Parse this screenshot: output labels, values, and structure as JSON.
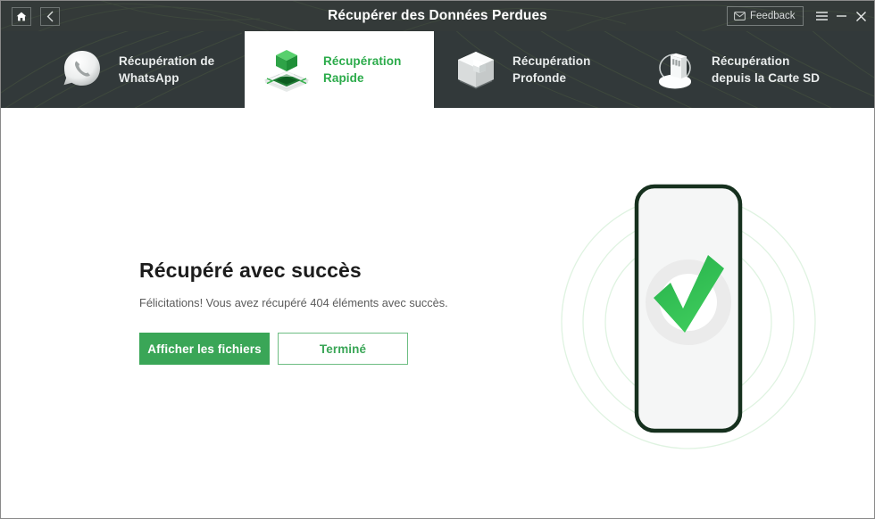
{
  "window": {
    "title": "Récupérer des Données Perdues",
    "home_icon": "home-icon",
    "back_icon": "chevron-left-icon",
    "feedback_label": "Feedback",
    "feedback_icon": "envelope-icon",
    "menu_icon": "hamburger-menu-icon",
    "minimize_icon": "minimize-icon",
    "close_icon": "close-icon"
  },
  "tabs": [
    {
      "label": "Récupération de\nWhatsApp",
      "icon": "whatsapp-bubble-icon",
      "active": false
    },
    {
      "label": "Récupération\nRapide",
      "icon": "green-cube-icon",
      "active": true
    },
    {
      "label": "Récupération\nProfonde",
      "icon": "gray-cube-icon",
      "active": false
    },
    {
      "label": "Récupération\ndepuis la Carte SD",
      "icon": "sd-card-icon",
      "active": false
    }
  ],
  "main": {
    "headline": "Récupéré avec succès",
    "subline": "Félicitations! Vous avez récupéré 404 éléments avec succès.",
    "recovered_count": "404",
    "primary_button": "Afficher les fichiers",
    "secondary_button": "Terminé",
    "illustration": "phone-with-green-checkmark"
  },
  "colors": {
    "accent_green": "#3aa657",
    "tab_active_green": "#2bab4a",
    "titlebar_dark": "#343a39",
    "tabbar_dark": "#32393a",
    "phone_frame": "#16301e",
    "ring_green": "#e4f5e6"
  }
}
